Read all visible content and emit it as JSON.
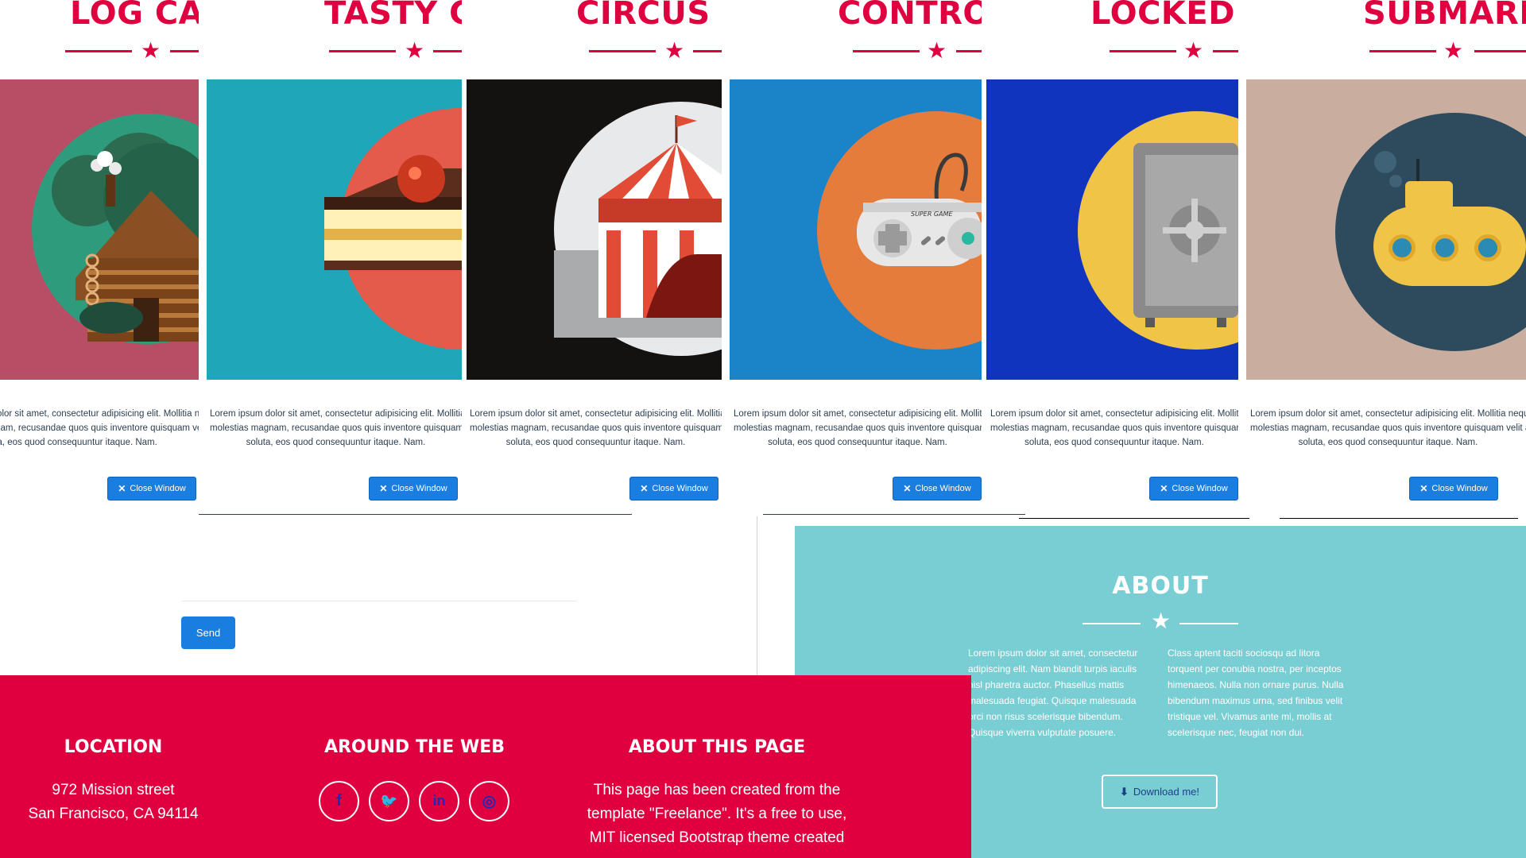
{
  "modals": [
    {
      "title": "LOG CABIN",
      "desc_lines": [
        "Lorem ipsum dolor sit amet, consectetur adipisicing elit. Mollitia neque assumenda ipsam nihil, molestias magnam, recusandae quos quis inventore quisquam velit asperiores, vitae? Reprehenderit soluta, eos quod consequuntur itaque. Nam."
      ],
      "close_label": "Close Window",
      "bg": "#b84d66",
      "disc": "#2e7c5c"
    },
    {
      "title": "TASTY CAKE",
      "close_label": "Close Window",
      "bg": "#1fa6b8",
      "disc": "#e45b4c"
    },
    {
      "title": "CIRCUS TENT",
      "close_label": "Close Window",
      "bg": "#141111",
      "disc": "#e8e9ea"
    },
    {
      "title": "CONTROLLER",
      "close_label": "Close Window",
      "bg": "#1b84c9",
      "disc": "#e57c3b"
    },
    {
      "title": "LOCKED SAFE",
      "close_label": "Close Window",
      "bg": "#1134bf",
      "disc": "#f0c447"
    },
    {
      "title": "SUBMARINE",
      "close_label": "Close Window",
      "bg": "#c9aea0",
      "disc": "#2e4b5e"
    }
  ],
  "desc": {
    "line1": "Lorem ipsum dolor sit amet, consectetur adipisicing elit. Mollitia neque assumenda ipsam nihil,",
    "line2": "molestias magnam, recusandae quos quis inventore quisquam velit asperiores, vitae? Reprehenderit",
    "line3": "soluta, eos quod consequuntur itaque. Nam."
  },
  "contact": {
    "send_label": "Send"
  },
  "about": {
    "title": "ABOUT",
    "col1": "Lorem ipsum dolor sit amet, consectetur adipiscing elit. Nam blandit turpis iaculis nisl pharetra auctor. Phasellus mattis malesuada feugiat. Quisque malesuada orci non risus scelerisque bibendum. Quisque viverra vulputate posuere.",
    "col2": "Class aptent taciti sociosqu ad litora torquent per conubia nostra, per inceptos himenaeos. Nulla non ornare purus. Nulla bibendum maximus urna, sed finibus velit tristique vel. Vivamus ante mi, mollis at scelerisque nec, feugiat non dui.",
    "download_label": "Download me!"
  },
  "footer": {
    "location_title": "LOCATION",
    "address1": "972 Mission street",
    "address2": "San Francisco, CA 94114",
    "web_title": "AROUND THE WEB",
    "social": [
      "facebook-icon",
      "twitter-icon",
      "linkedin-icon",
      "dribbble-icon"
    ],
    "about_title": "ABOUT THIS PAGE",
    "about_line1": "This page has been created from the",
    "about_line2": "template \"Freelance\". It's a free to use,",
    "about_line3": "MIT licensed Bootstrap theme created"
  }
}
